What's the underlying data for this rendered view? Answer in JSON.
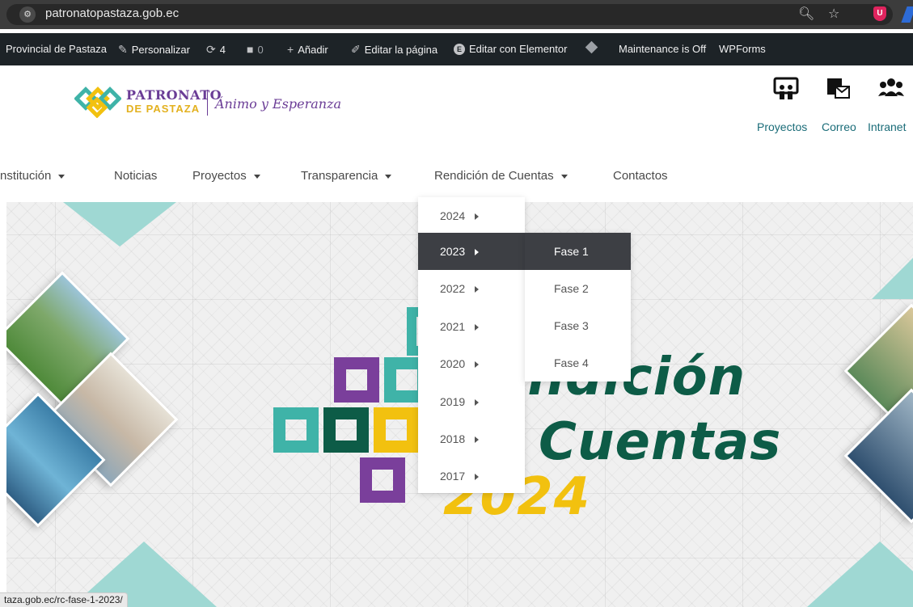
{
  "browser": {
    "url": "patronatopastaza.gob.ec",
    "status_url": "taza.gob.ec/rc-fase-1-2023/",
    "icons": [
      "site-controls-icon",
      "zoom-icon",
      "star-icon",
      "ublock-icon"
    ]
  },
  "adminbar": {
    "site": "Provincial de Pastaza",
    "customize": "Personalizar",
    "updates": "4",
    "comments": "0",
    "add_new": "Añadir",
    "edit_page": "Editar la página",
    "edit_elementor": "Editar con Elementor",
    "maintenance": "Maintenance is Off",
    "wpforms": "WPForms"
  },
  "header": {
    "logo_line1": "PATRONATO",
    "logo_line2": "DE PASTAZA",
    "slogan": "Ánimo y Esperanza",
    "links": [
      "Proyectos",
      "Correo",
      "Intranet"
    ]
  },
  "nav": {
    "items": [
      {
        "label": "nstitución",
        "has_caret": true
      },
      {
        "label": "Noticias",
        "has_caret": false
      },
      {
        "label": "Proyectos",
        "has_caret": true
      },
      {
        "label": "Transparencia",
        "has_caret": true
      },
      {
        "label": "Rendición de Cuentas",
        "has_caret": true
      },
      {
        "label": "Contactos",
        "has_caret": false
      }
    ]
  },
  "dropdown": {
    "years": [
      "2024",
      "2023",
      "2022",
      "2021",
      "2020",
      "2019",
      "2018",
      "2017"
    ],
    "active_year": "2023",
    "phases": [
      "Fase 1",
      "Fase 2",
      "Fase 3",
      "Fase 4"
    ],
    "active_phase": "Fase 1"
  },
  "hero": {
    "line1": "endición",
    "line2": "Cuentas",
    "year": "2024"
  },
  "colors": {
    "purple": "#7a3f9b",
    "teal": "#3fb3a8",
    "dark_green": "#0d5c47",
    "yellow": "#f2c10f",
    "link_teal": "#1a6c78"
  }
}
